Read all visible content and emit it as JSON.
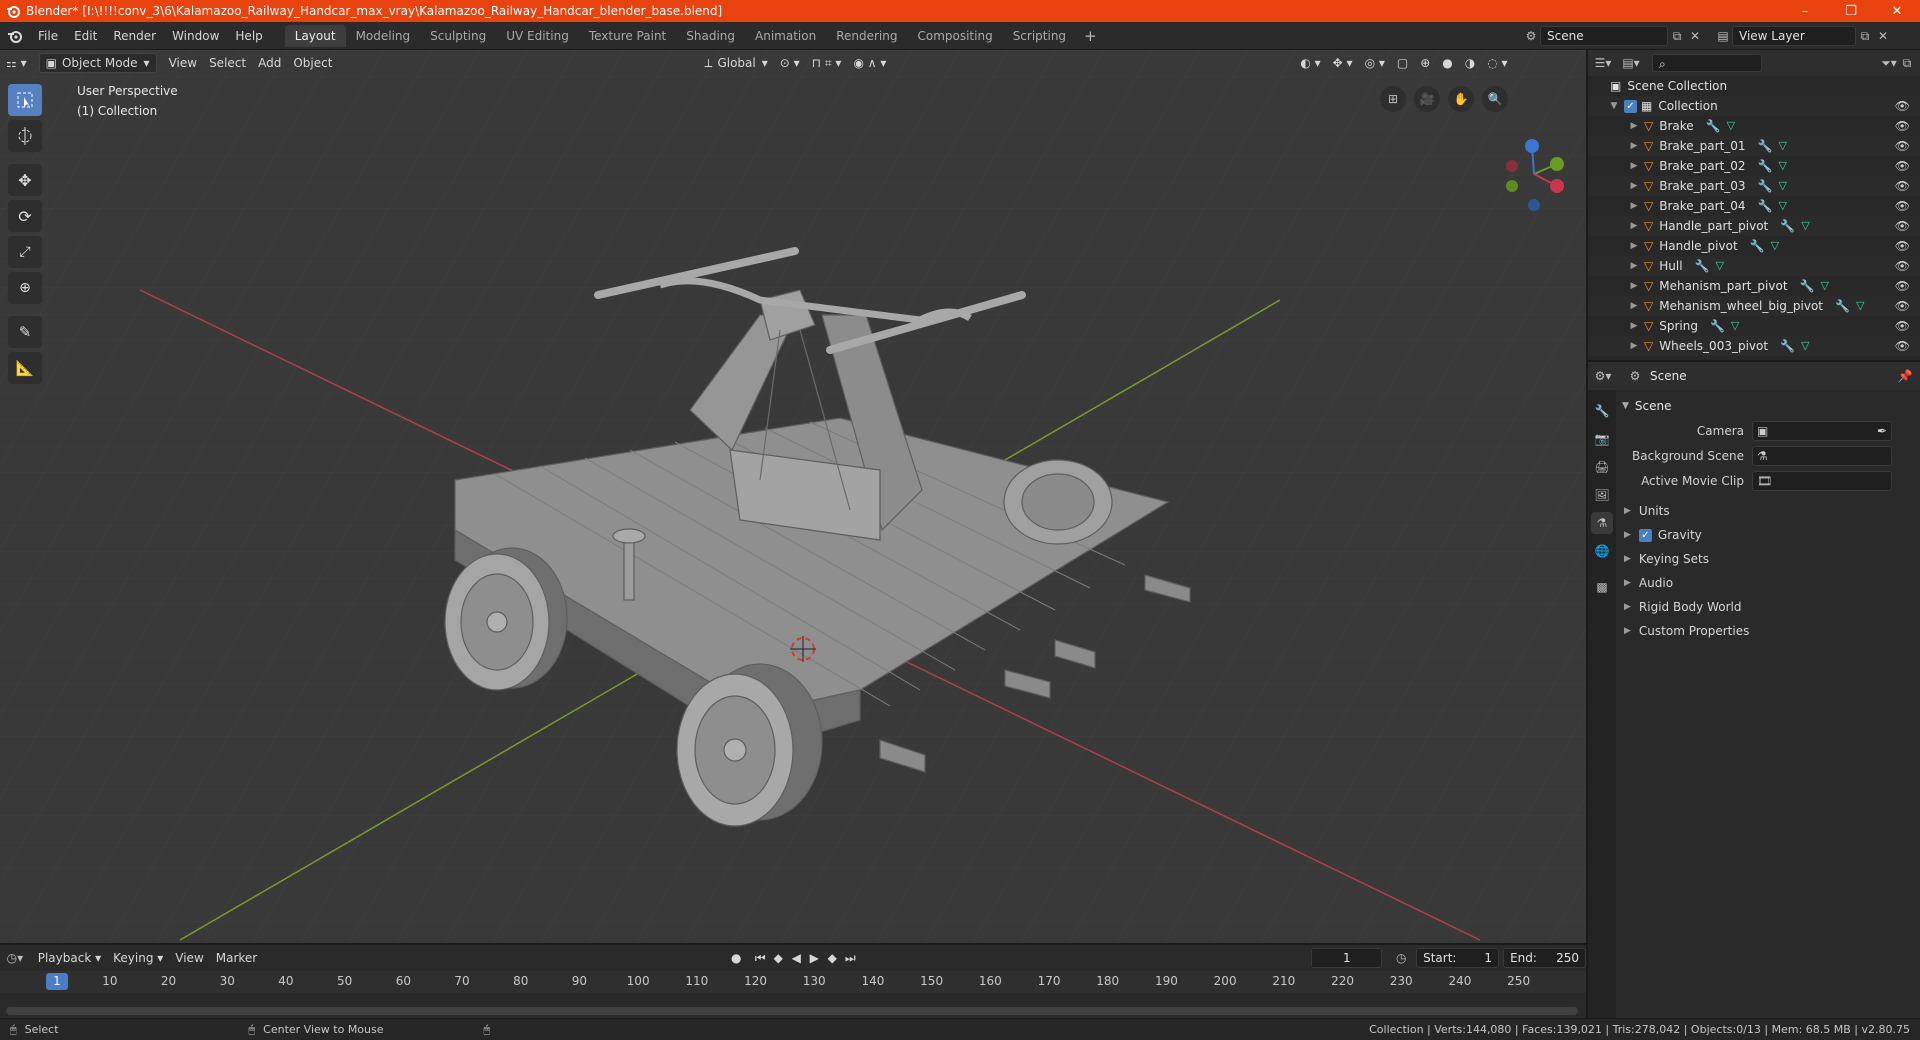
{
  "window": {
    "title": "Blender* [I:\\!!!!conv_3\\6\\Kalamazoo_Railway_Handcar_max_vray\\Kalamazoo_Railway_Handcar_blender_base.blend]",
    "minimize": "–",
    "maximize": "❐",
    "close": "✕"
  },
  "menu": [
    "File",
    "Edit",
    "Render",
    "Window",
    "Help"
  ],
  "workspaces": [
    "Layout",
    "Modeling",
    "Sculpting",
    "UV Editing",
    "Texture Paint",
    "Shading",
    "Animation",
    "Rendering",
    "Compositing",
    "Scripting"
  ],
  "workspace_add": "+",
  "scene_name": "Scene",
  "view_layer": "View Layer",
  "viewport": {
    "mode": "Object Mode",
    "header_menus": [
      "View",
      "Select",
      "Add",
      "Object"
    ],
    "orientation": "Global",
    "perspective_label": "User Perspective",
    "collection_label": "(1) Collection"
  },
  "outliner": {
    "root": "Scene Collection",
    "collection": "Collection",
    "items": [
      "Brake",
      "Brake_part_01",
      "Brake_part_02",
      "Brake_part_03",
      "Brake_part_04",
      "Handle_part_pivot",
      "Handle_pivot",
      "Hull",
      "Mehanism_part_pivot",
      "Mehanism_wheel_big_pivot",
      "Spring",
      "Wheels_003_pivot"
    ]
  },
  "properties": {
    "header": "Scene",
    "panel": "Scene",
    "fields": [
      {
        "label": "Camera"
      },
      {
        "label": "Background Scene"
      },
      {
        "label": "Active Movie Clip"
      }
    ],
    "subpanels": [
      "Units",
      "Gravity",
      "Keying Sets",
      "Audio",
      "Rigid Body World",
      "Custom Properties"
    ]
  },
  "timeline": {
    "menus": [
      "Playback",
      "Keying",
      "View",
      "Marker"
    ],
    "current_frame": "1",
    "start_label": "Start:",
    "start": "1",
    "end_label": "End:",
    "end": "250",
    "ticks": [
      "10",
      "20",
      "30",
      "40",
      "50",
      "60",
      "70",
      "80",
      "90",
      "100",
      "110",
      "120",
      "130",
      "140",
      "150",
      "160",
      "170",
      "180",
      "190",
      "200",
      "210",
      "220",
      "230",
      "240",
      "250"
    ]
  },
  "status": {
    "select": "Select",
    "center_view": "Center View to Mouse",
    "stats": "Collection | Verts:144,080 | Faces:139,021 | Tris:278,042 | Objects:0/13 | Mem: 68.5 MB | v2.80.75"
  },
  "colors": {
    "titlebar": "#e8420f",
    "accent": "#4b7cc7",
    "x_axis": "#c8374b",
    "y_axis": "#6a9b26",
    "z_axis": "#3a76d1"
  }
}
